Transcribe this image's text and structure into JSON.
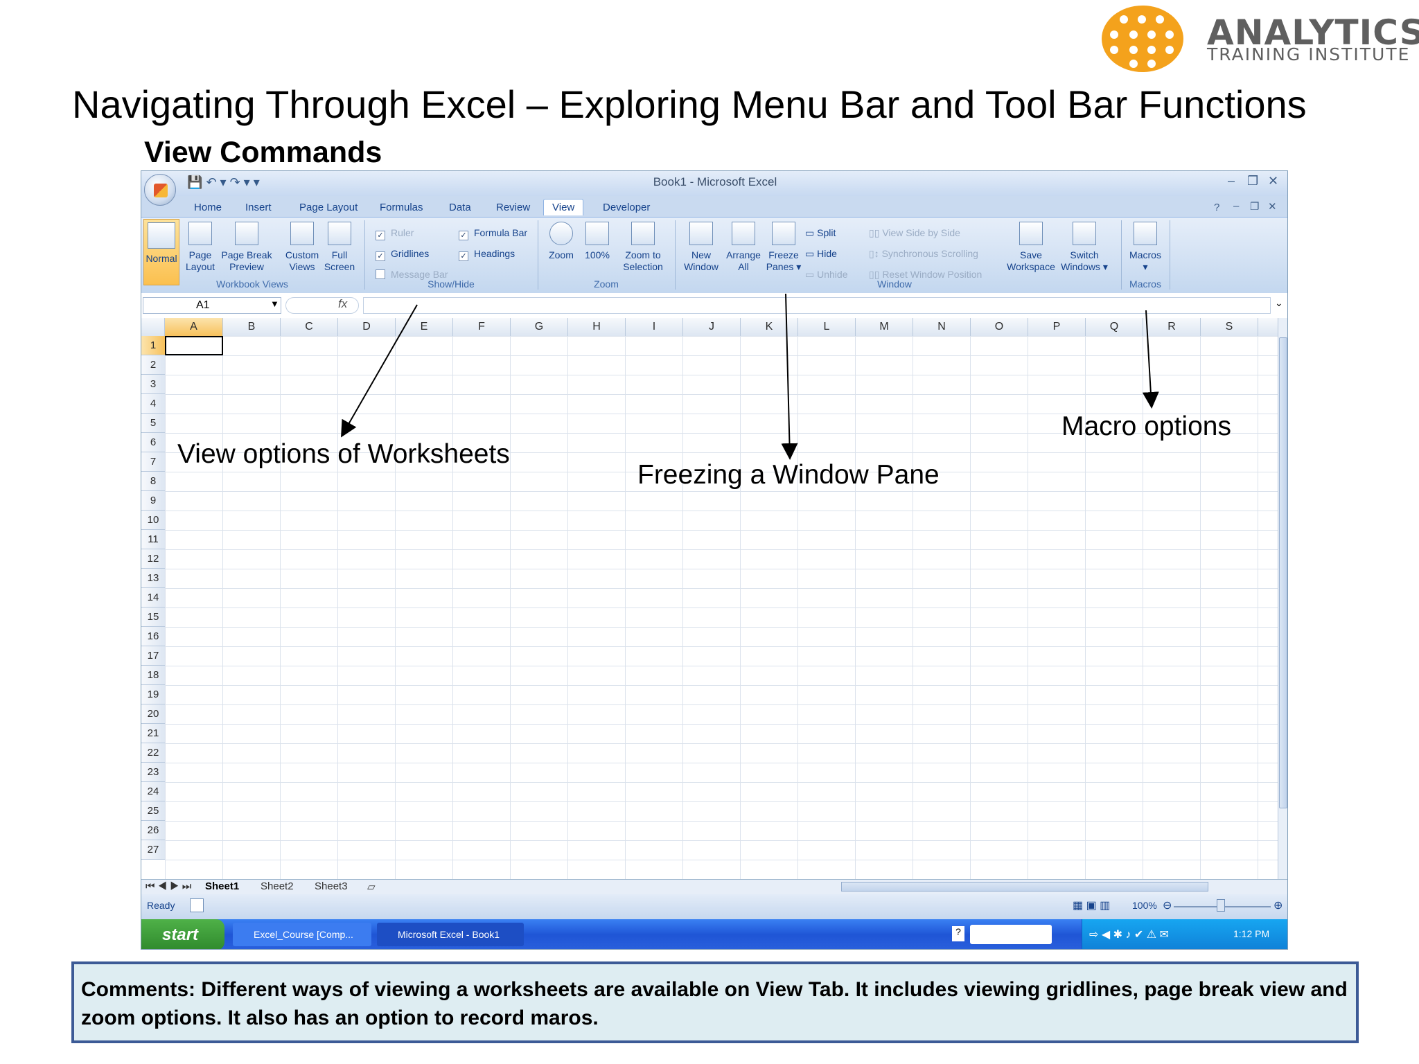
{
  "logo": {
    "word": "ANALYTICS",
    "subtitle": "TRAINING INSTITUTE",
    "accent": "#f4a21c"
  },
  "slide": {
    "title": "Navigating Through Excel – Exploring Menu Bar and Tool Bar Functions",
    "subtitle": "View Commands"
  },
  "excel": {
    "window_title": "Book1 - Microsoft Excel",
    "tabs": [
      "Home",
      "Insert",
      "Page Layout",
      "Formulas",
      "Data",
      "Review",
      "View",
      "Developer"
    ],
    "active_tab": "View",
    "groups": {
      "workbook_views": {
        "label": "Workbook Views",
        "normal": "Normal",
        "page_layout": [
          "Page",
          "Layout"
        ],
        "page_break": [
          "Page Break",
          "Preview"
        ],
        "custom_views": [
          "Custom",
          "Views"
        ],
        "full_screen": [
          "Full",
          "Screen"
        ]
      },
      "show_hide": {
        "label": "Show/Hide",
        "ruler": "Ruler",
        "gridlines": "Gridlines",
        "message_bar": "Message Bar",
        "formula_bar": "Formula Bar",
        "headings": "Headings"
      },
      "zoom": {
        "label": "Zoom",
        "zoom": "Zoom",
        "hundred": "100%",
        "zoom_to_selection": [
          "Zoom to",
          "Selection"
        ]
      },
      "window": {
        "label": "Window",
        "new_window": [
          "New",
          "Window"
        ],
        "arrange_all": [
          "Arrange",
          "All"
        ],
        "freeze_panes": [
          "Freeze",
          "Panes ▾"
        ],
        "split": "Split",
        "hide": "Hide",
        "unhide": "Unhide",
        "view_side_by_side": "View Side by Side",
        "sync_scrolling": "Synchronous Scrolling",
        "reset_window": "Reset Window Position",
        "save_workspace": [
          "Save",
          "Workspace"
        ],
        "switch_windows": [
          "Switch",
          "Windows ▾"
        ]
      },
      "macros": {
        "label": "Macros",
        "button": "Macros"
      }
    },
    "name_box": "A1",
    "fx": "fx",
    "columns": [
      "A",
      "B",
      "C",
      "D",
      "E",
      "F",
      "G",
      "H",
      "I",
      "J",
      "K",
      "L",
      "M",
      "N",
      "O",
      "P",
      "Q",
      "R",
      "S"
    ],
    "rows": [
      "1",
      "2",
      "3",
      "4",
      "5",
      "6",
      "7",
      "8",
      "9",
      "10",
      "11",
      "12",
      "13",
      "14",
      "15",
      "16",
      "17",
      "18",
      "19",
      "20",
      "21",
      "22",
      "23",
      "24",
      "25",
      "26",
      "27"
    ],
    "sheets": [
      "Sheet1",
      "Sheet2",
      "Sheet3"
    ],
    "status": "Ready",
    "zoom_level": "100%"
  },
  "taskbar": {
    "start": "start",
    "items": [
      "Excel_Course [Comp...",
      "Microsoft Excel - Book1"
    ],
    "clock": "1:12 PM"
  },
  "annotations": {
    "view_options": "View options of Worksheets",
    "freezing": "Freezing a Window Pane",
    "macro": "Macro options"
  },
  "comments": "Comments: Different ways of viewing a worksheets are available on View Tab. It includes viewing gridlines, page break view and zoom options. It also has an option to record maros."
}
